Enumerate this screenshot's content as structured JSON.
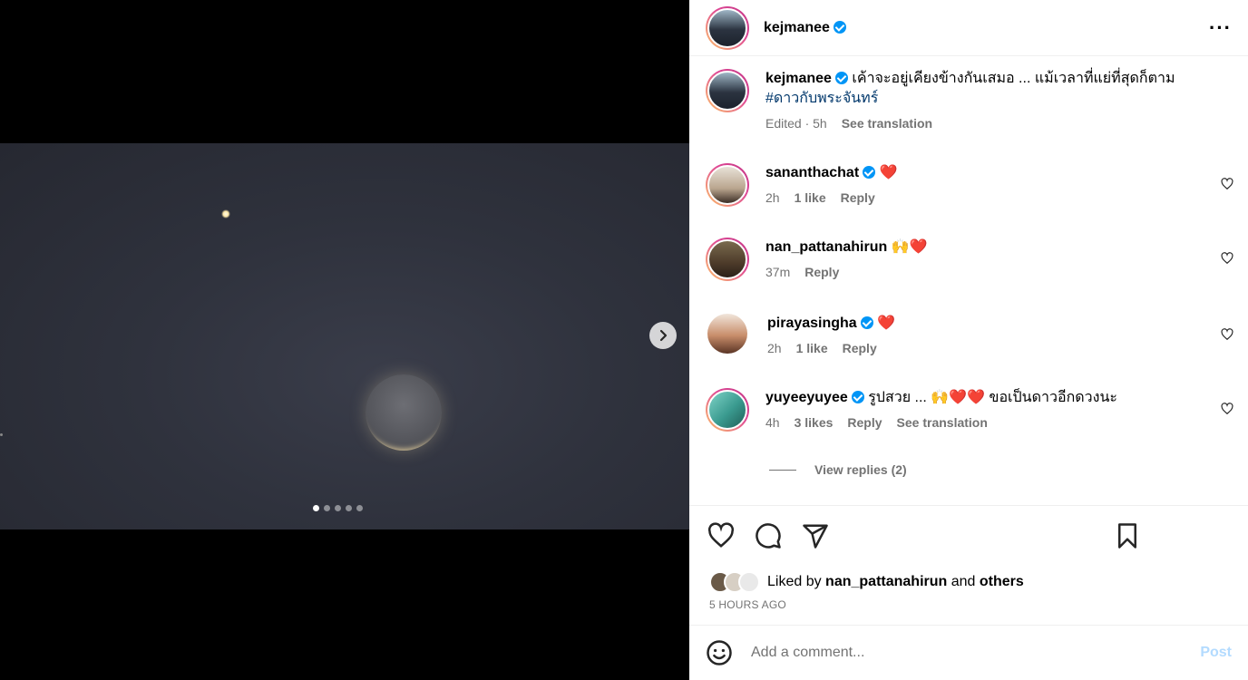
{
  "media": {
    "carousel_count": 5,
    "active_index": 0,
    "next_icon": "chevron-right-icon"
  },
  "header": {
    "username": "kejmanee",
    "more_icon": "more-horizontal-icon"
  },
  "caption": {
    "username": "kejmanee",
    "text": "เค้าจะอยู่เคียงข้างกันเสมอ ... แม้เวลาที่แย่ที่สุดก็ตาม",
    "hashtag": "#ดาวกับพระจันทร์",
    "edited": "Edited · 5h",
    "see_translation": "See translation"
  },
  "comments": [
    {
      "username": "sananthachat",
      "verified": true,
      "text": "❤️",
      "time": "2h",
      "likes": "1 like",
      "reply": "Reply"
    },
    {
      "username": "nan_pattanahirun",
      "verified": false,
      "text": "🙌❤️",
      "time": "37m",
      "likes": "",
      "reply": "Reply"
    },
    {
      "username": "pirayasingha",
      "verified": true,
      "text": "❤️",
      "time": "2h",
      "likes": "1 like",
      "reply": "Reply"
    },
    {
      "username": "yuyeeyuyee",
      "verified": true,
      "text": "รูปสวย ... 🙌❤️❤️ ขอเป็นดาวอีกดวงนะ",
      "time": "4h",
      "likes": "3 likes",
      "reply": "Reply",
      "see_translation": "See translation"
    }
  ],
  "view_replies": "View replies (2)",
  "actions": {
    "like_icon": "heart-icon",
    "comment_icon": "comment-icon",
    "share_icon": "send-icon",
    "save_icon": "bookmark-icon"
  },
  "liked_by": {
    "prefix": "Liked by",
    "user": "nan_pattanahirun",
    "and": "and",
    "others": "others"
  },
  "post_time": "5 HOURS AGO",
  "comment_box": {
    "placeholder": "Add a comment...",
    "post_label": "Post",
    "emoji_icon": "smile-icon"
  },
  "colors": {
    "verified": "#0095f6",
    "hashtag": "#00376b",
    "muted": "#737373",
    "post_disabled": "#b3dbff",
    "heart": "#e0245e"
  }
}
